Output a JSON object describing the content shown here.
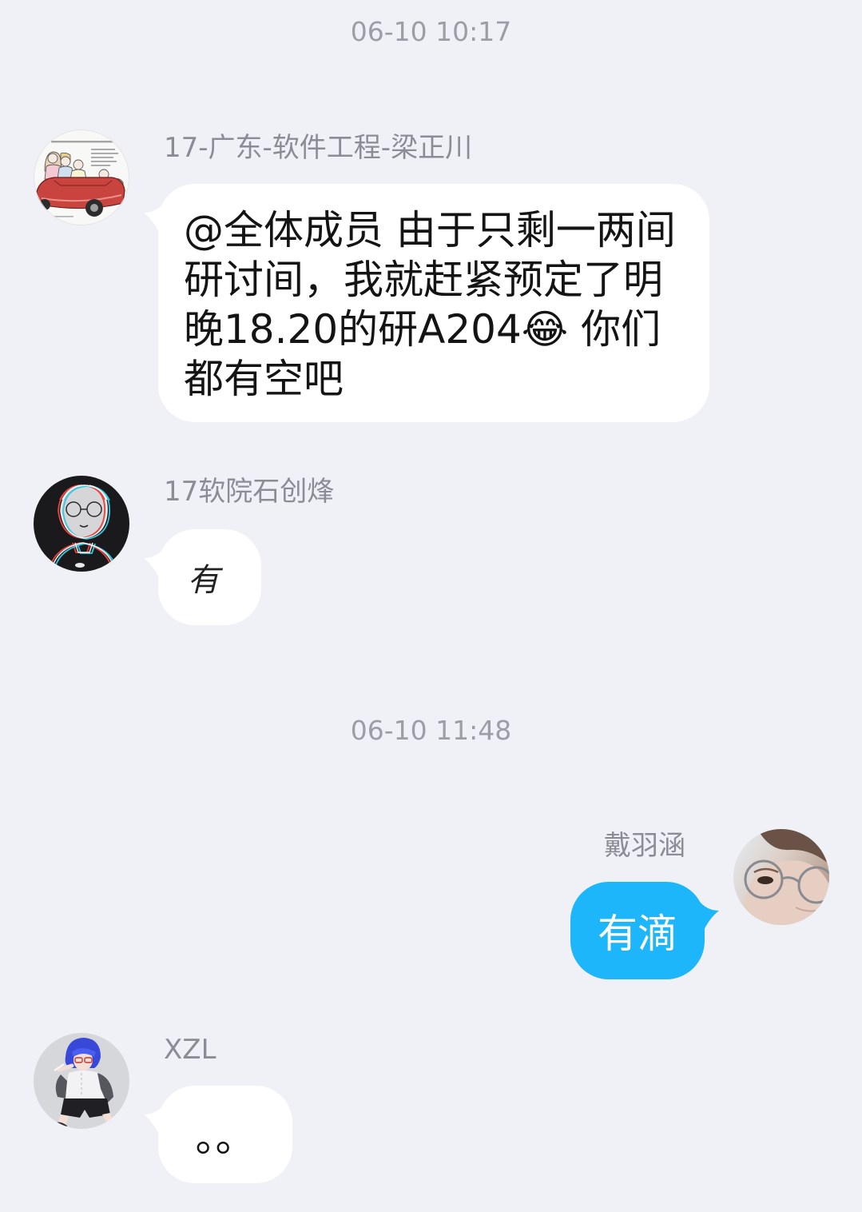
{
  "colors": {
    "bg": "#F0F1F6",
    "bubble_other": "#FFFFFF",
    "bubble_self": "#1EB6FA",
    "meta": "#9C9DA6",
    "name": "#8B8C95",
    "ink": "#141414",
    "self_ink": "#FFFFFF"
  },
  "timestamps": [
    "06-10 10:17",
    "06-10 11:48"
  ],
  "messages": [
    {
      "sender": "17-广东-软件工程-梁正川",
      "from_self": false,
      "avatar_icon": "red-car-cartoon-avatar",
      "lines": [
        "@全体成员 由于只剩一两间",
        "研讨间，我就赶紧预定了明",
        "晚18.20的研A204😂 你们",
        "都有空吧"
      ]
    },
    {
      "sender": "17软院石创烽",
      "from_self": false,
      "avatar_icon": "glitch-sketch-avatar",
      "text": "有"
    },
    {
      "sender": "戴羽涵",
      "from_self": true,
      "avatar_icon": "glasses-portrait-avatar",
      "text": "有滴"
    },
    {
      "sender": "XZL",
      "from_self": false,
      "avatar_icon": "blue-hair-anime-avatar",
      "text": "。。"
    }
  ]
}
